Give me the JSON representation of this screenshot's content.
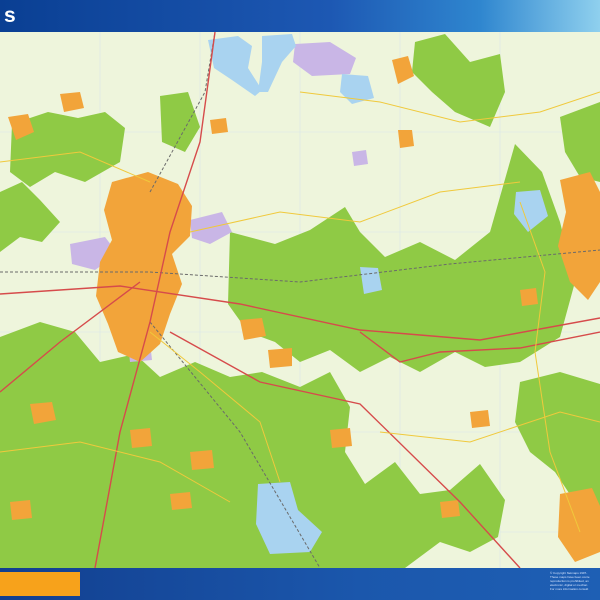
{
  "header": {
    "title": "s"
  },
  "map": {
    "colors": {
      "background": "#eef5dc",
      "forest": "#8fca45",
      "urban": "#f2a43a",
      "industrial": "#c9b6e6",
      "water": "#a9d3f0",
      "road_major": "#d64b4b",
      "road_secondary": "#f0c93c",
      "rail": "#6a6a6a",
      "grid": "#d9e6ea"
    }
  },
  "footer": {
    "accent_color": "#f7a21b",
    "copyright_lines": [
      "© Copyright Netmaps 1997-",
      "These maps have been conte",
      "reproduction is prohibited, an",
      "electronic, digital or mechan",
      "For more information consult"
    ]
  }
}
